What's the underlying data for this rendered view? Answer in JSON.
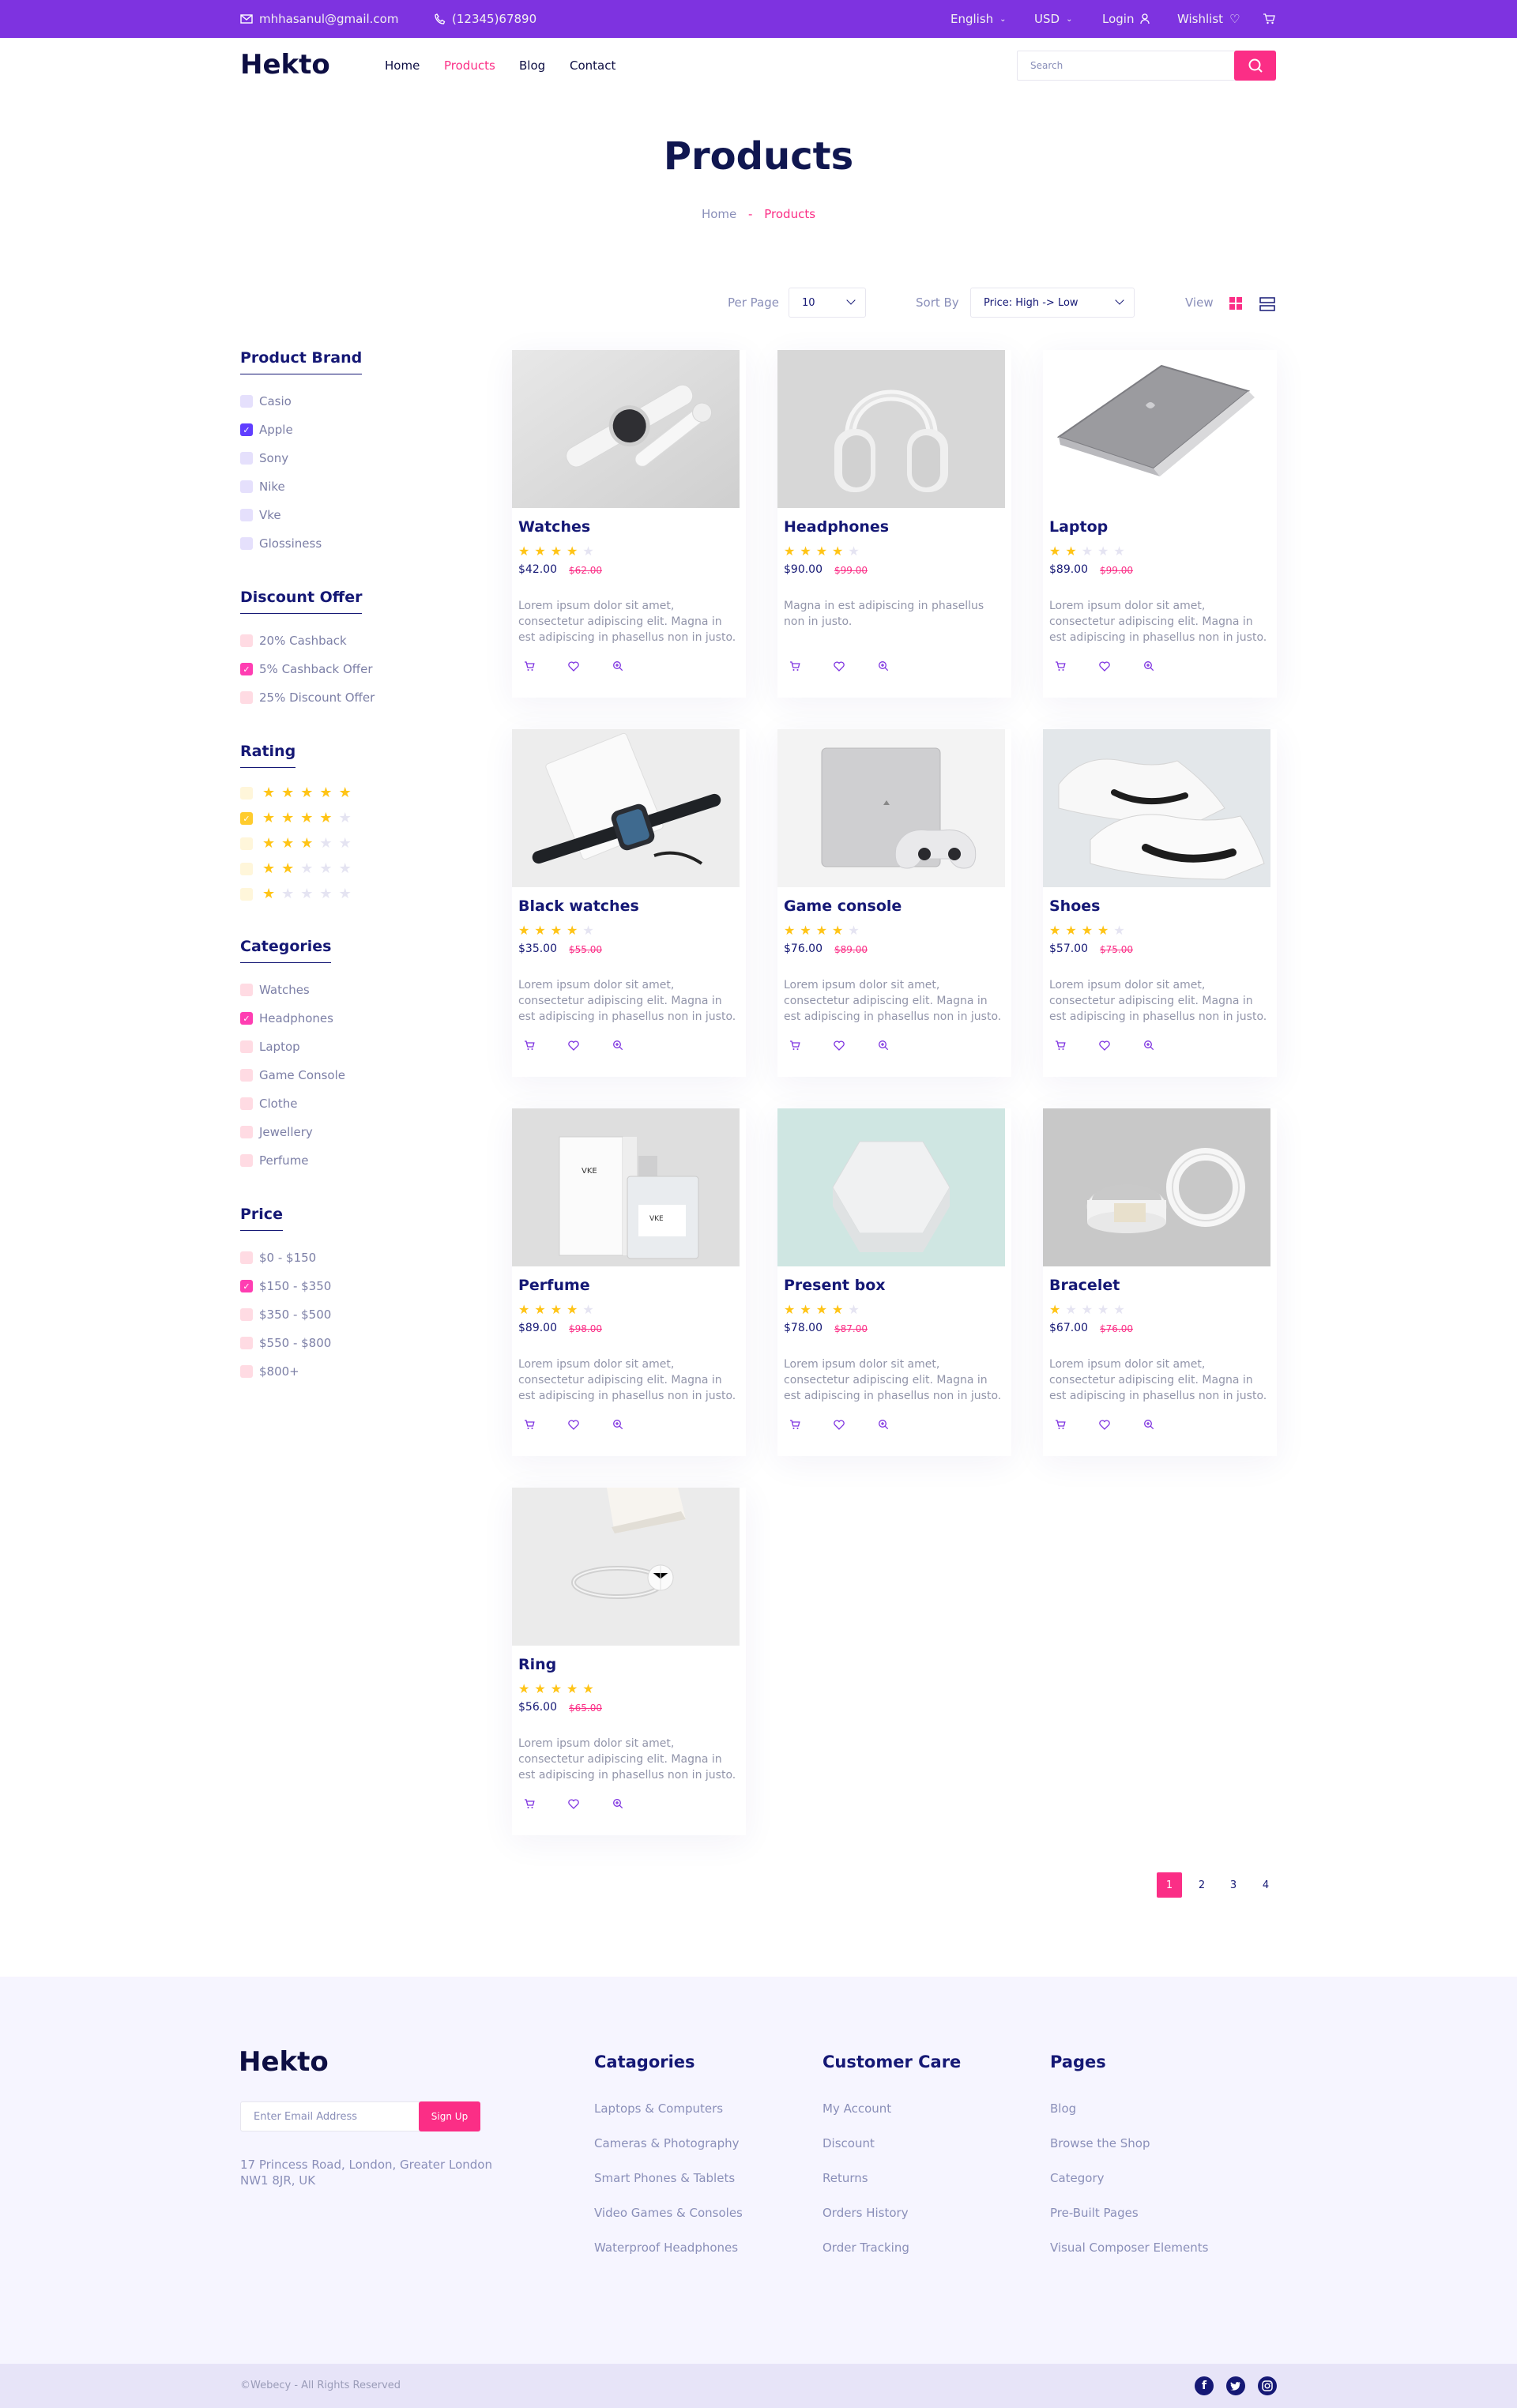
{
  "topbar": {
    "email": "mhhasanul@gmail.com",
    "phone": "(12345)67890",
    "language": "English",
    "currency": "USD",
    "login": "Login",
    "wishlist": "Wishlist"
  },
  "nav": {
    "logo": "Hekto",
    "links": [
      "Home",
      "Products",
      "Blog",
      "Contact"
    ],
    "active": "Products",
    "search_placeholder": "Search"
  },
  "page": {
    "title": "Products",
    "breadcrumb_home": "Home",
    "breadcrumb_sep": "-",
    "breadcrumb_current": "Products"
  },
  "controls": {
    "per_page_label": "Per Page",
    "per_page_value": "10",
    "sort_label": "Sort By",
    "sort_value": "Price: High -> Low",
    "view_label": "View"
  },
  "filters": {
    "brand": {
      "title": "Product Brand",
      "items": [
        {
          "label": "Casio",
          "checked": false
        },
        {
          "label": "Apple",
          "checked": true
        },
        {
          "label": "Sony",
          "checked": false
        },
        {
          "label": "Nike",
          "checked": false
        },
        {
          "label": "Vke",
          "checked": false
        },
        {
          "label": "Glossiness",
          "checked": false
        }
      ]
    },
    "discount": {
      "title": "Discount Offer",
      "items": [
        {
          "label": "20% Cashback",
          "checked": false
        },
        {
          "label": "5% Cashback Offer",
          "checked": true
        },
        {
          "label": "25% Discount Offer",
          "checked": false
        }
      ]
    },
    "rating": {
      "title": "Rating",
      "items": [
        {
          "stars": 5,
          "checked": false
        },
        {
          "stars": 4,
          "checked": true
        },
        {
          "stars": 3,
          "checked": false
        },
        {
          "stars": 2,
          "checked": false
        },
        {
          "stars": 1,
          "checked": false
        }
      ]
    },
    "categories": {
      "title": "Categories",
      "items": [
        {
          "label": "Watches",
          "checked": false
        },
        {
          "label": "Headphones",
          "checked": true
        },
        {
          "label": "Laptop",
          "checked": false
        },
        {
          "label": "Game Console",
          "checked": false
        },
        {
          "label": "Clothe",
          "checked": false
        },
        {
          "label": "Jewellery",
          "checked": false
        },
        {
          "label": "Perfume",
          "checked": false
        }
      ]
    },
    "price": {
      "title": "Price",
      "items": [
        {
          "label": "$0 - $150",
          "checked": false
        },
        {
          "label": "$150 - $350",
          "checked": true
        },
        {
          "label": "$350 - $500",
          "checked": false
        },
        {
          "label": "$550 - $800",
          "checked": false
        },
        {
          "label": "$800+",
          "checked": false
        }
      ]
    }
  },
  "products": [
    {
      "name": "Watches",
      "stars": 4,
      "price": "$42.00",
      "old": "$62.00",
      "desc": "Lorem ipsum dolor sit amet, consectetur adipiscing elit. Magna in est adipiscing in phasellus non in justo.",
      "image": "smartwatch",
      "bg": "#dcdcdc"
    },
    {
      "name": "Headphones",
      "stars": 4,
      "price": "$90.00",
      "old": "$99.00",
      "desc": "Magna in est adipiscing in phasellus non in justo.",
      "image": "headphones",
      "bg": "#d6d6d6"
    },
    {
      "name": "Laptop",
      "stars": 2,
      "price": "$89.00",
      "old": "$99.00",
      "desc": "Lorem ipsum dolor sit amet, consectetur adipiscing elit. Magna in est adipiscing in phasellus non in justo.",
      "image": "laptop",
      "bg": "#ffffff"
    },
    {
      "name": "Black watches",
      "stars": 4,
      "price": "$35.00",
      "old": "$55.00",
      "desc": "Lorem ipsum dolor sit amet, consectetur adipiscing elit. Magna in est adipiscing in phasellus non in justo.",
      "image": "black-watch",
      "bg": "#ececec"
    },
    {
      "name": "Game console",
      "stars": 4,
      "price": "$76.00",
      "old": "$89.00",
      "desc": "Lorem ipsum dolor sit amet, consectetur adipiscing elit. Magna in est adipiscing in phasellus non in justo.",
      "image": "game-console",
      "bg": "#f3f3f3"
    },
    {
      "name": "Shoes",
      "stars": 4,
      "price": "$57.00",
      "old": "$75.00",
      "desc": "Lorem ipsum dolor sit amet, consectetur adipiscing elit. Magna in est adipiscing in phasellus non in justo.",
      "image": "shoes",
      "bg": "#e4e7ea"
    },
    {
      "name": "Perfume",
      "stars": 4,
      "price": "$89.00",
      "old": "$98.00",
      "desc": "Lorem ipsum dolor sit amet, consectetur adipiscing elit. Magna in est adipiscing in phasellus non in justo.",
      "image": "perfume",
      "bg": "#dedede"
    },
    {
      "name": "Present box",
      "stars": 4,
      "price": "$78.00",
      "old": "$87.00",
      "desc": "Lorem ipsum dolor sit amet, consectetur adipiscing elit. Magna in est adipiscing in phasellus non in justo.",
      "image": "present-box",
      "bg": "#cfe5e1"
    },
    {
      "name": "Bracelet",
      "stars": 1,
      "price": "$67.00",
      "old": "$76.00",
      "desc": "Lorem ipsum dolor sit amet, consectetur adipiscing elit. Magna in est adipiscing in phasellus non in justo.",
      "image": "bracelet",
      "bg": "#c9c9c9"
    },
    {
      "name": "Ring",
      "stars": 5,
      "price": "$56.00",
      "old": "$65.00",
      "desc": "Lorem ipsum dolor sit amet, consectetur adipiscing elit. Magna in est adipiscing in phasellus non in justo.",
      "image": "ring",
      "bg": "#e9e9e9"
    }
  ],
  "pagination": {
    "pages": [
      "1",
      "2",
      "3",
      "4"
    ],
    "current": "1"
  },
  "footer": {
    "logo": "Hekto",
    "email_placeholder": "Enter Email Address",
    "signup": "Sign Up",
    "address": "17 Princess Road, London, Greater London NW1 8JR, UK",
    "columns": [
      {
        "title": "Catagories",
        "links": [
          "Laptops & Computers",
          "Cameras & Photography",
          "Smart Phones & Tablets",
          "Video Games & Consoles",
          "Waterproof Headphones"
        ]
      },
      {
        "title": "Customer Care",
        "links": [
          "My Account",
          "Discount",
          "Returns",
          "Orders History",
          "Order Tracking"
        ]
      },
      {
        "title": "Pages",
        "links": [
          "Blog",
          "Browse the Shop",
          "Category",
          "Pre-Built Pages",
          "Visual Composer Elements"
        ]
      }
    ],
    "copyright": "©Webecy - All Rights Reserved",
    "social": [
      "facebook-icon",
      "twitter-icon",
      "instagram-icon"
    ]
  },
  "colors": {
    "purple": "#7e33e0",
    "pink": "#fb2e86",
    "navy": "#151875",
    "star": "#ffc416"
  }
}
